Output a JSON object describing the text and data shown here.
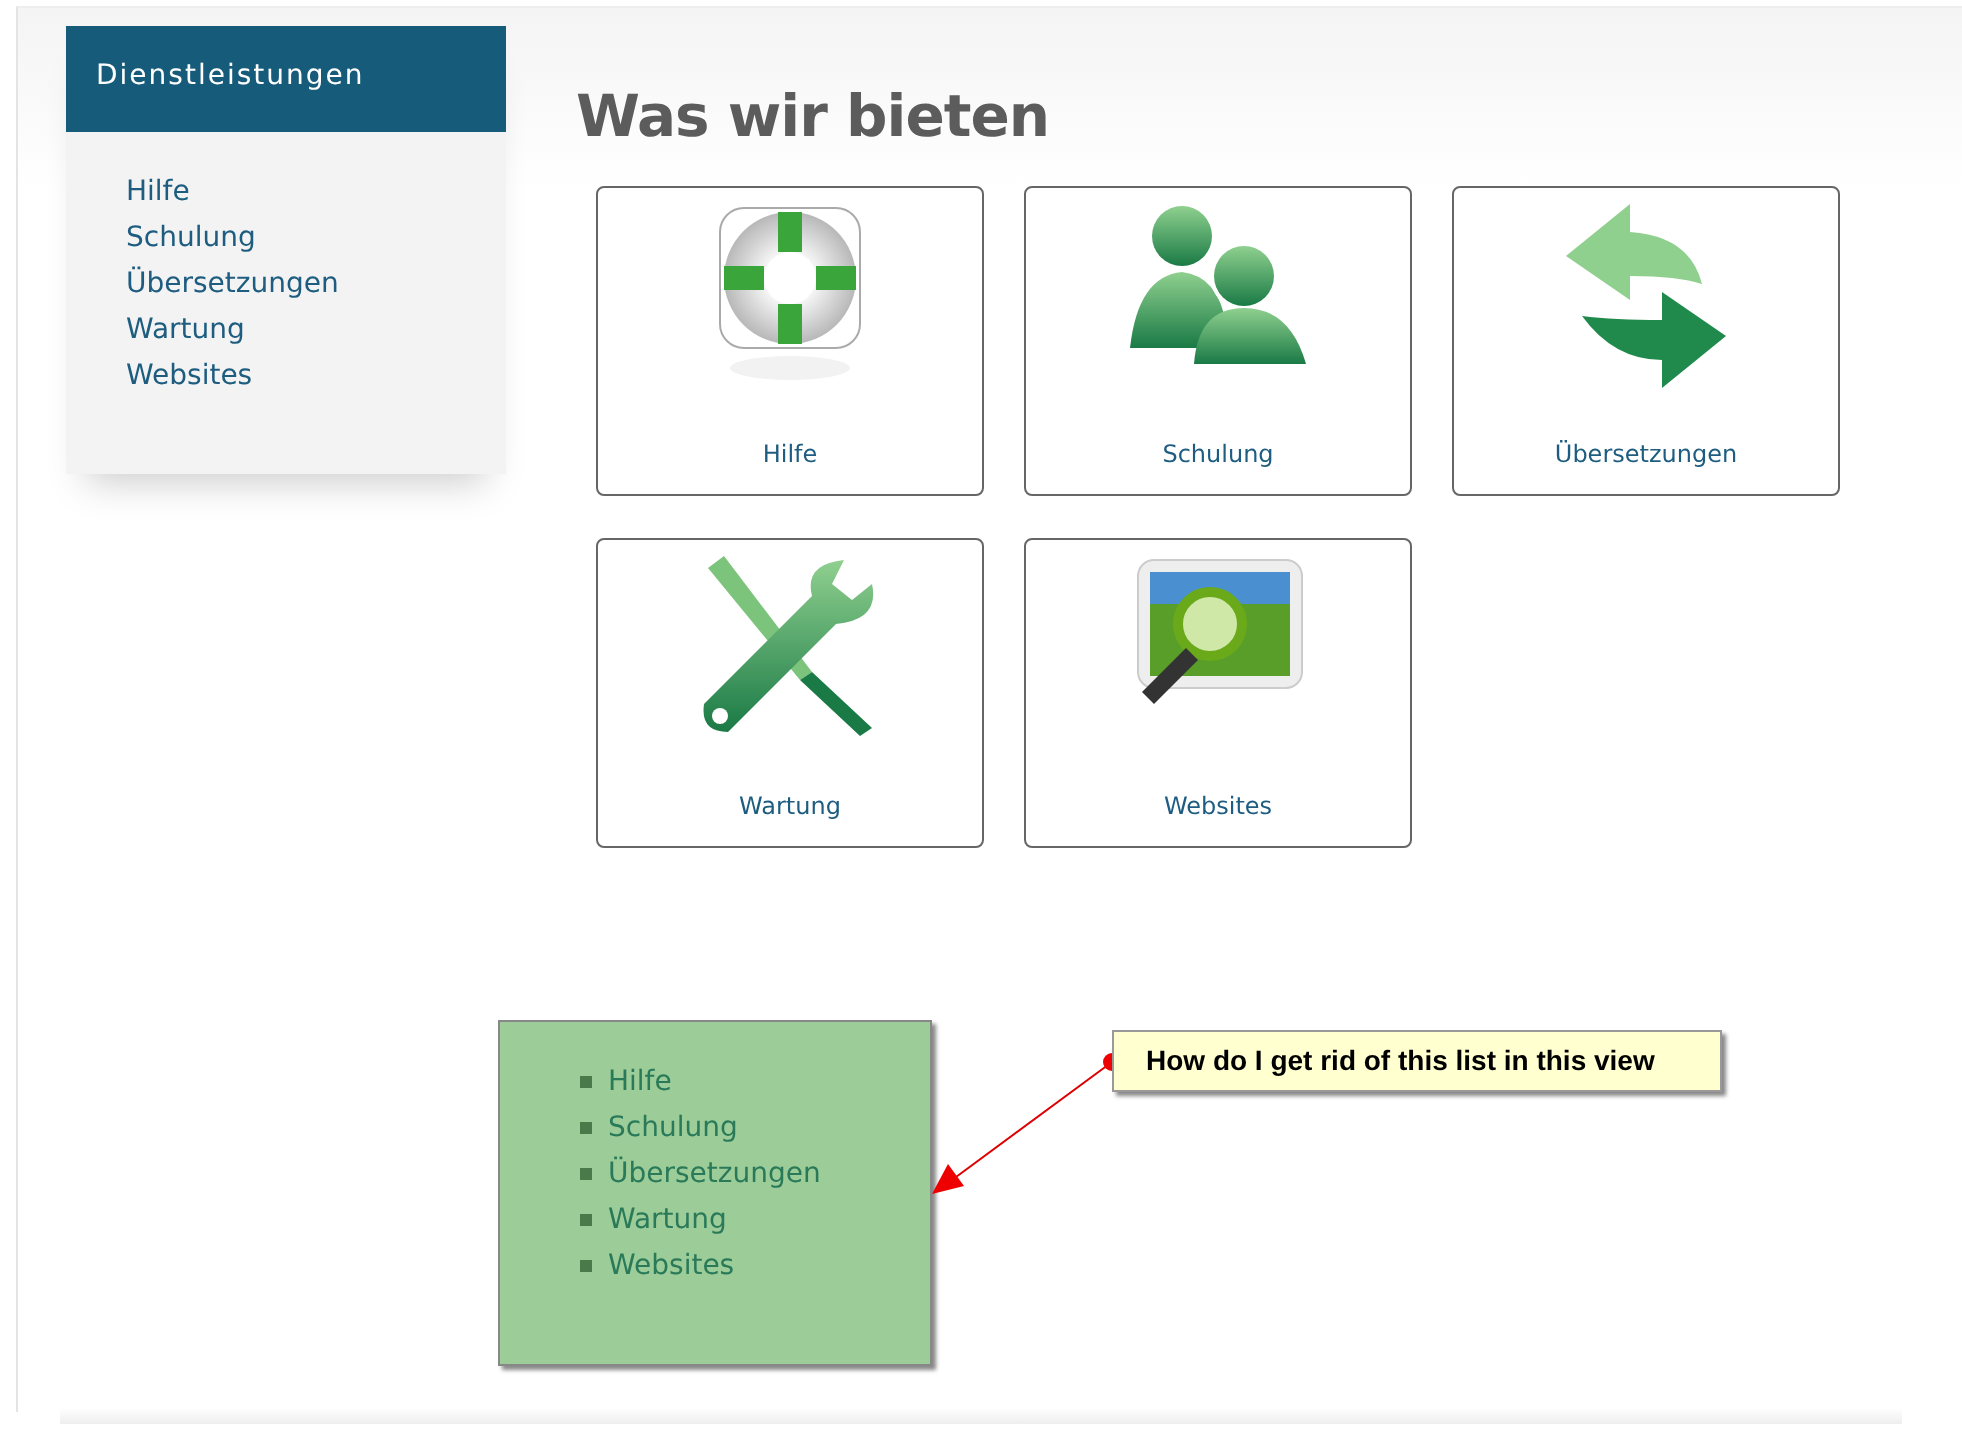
{
  "sidebar": {
    "title": "Dienstleistungen",
    "items": [
      "Hilfe",
      "Schulung",
      "Übersetzungen",
      "Wartung",
      "Websites"
    ]
  },
  "heading": "Was wir bieten",
  "tiles": [
    {
      "kind": "lifebuoy",
      "label": "Hilfe"
    },
    {
      "kind": "people",
      "label": "Schulung"
    },
    {
      "kind": "arrows",
      "label": "Übersetzungen"
    },
    {
      "kind": "tools",
      "label": "Wartung"
    },
    {
      "kind": "picture-search",
      "label": "Websites"
    }
  ],
  "duplicate_list": [
    "Hilfe",
    "Schulung",
    "Übersetzungen",
    "Wartung",
    "Websites"
  ],
  "callout": "How do I get rid of this list in this view"
}
